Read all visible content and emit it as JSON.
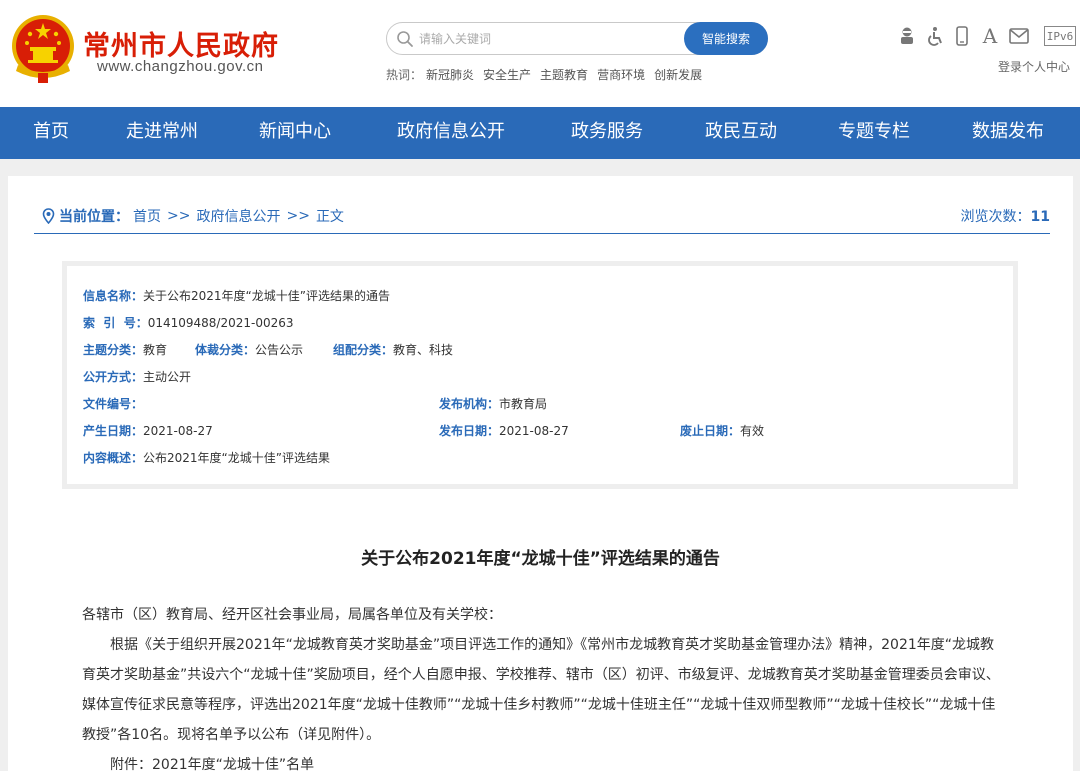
{
  "site": {
    "name": "常州市人民政府",
    "url": "www.changzhou.gov.cn"
  },
  "search": {
    "placeholder": "请输入关键词",
    "button_label": "智能搜索"
  },
  "hot": {
    "label": "热词：",
    "words": [
      "新冠肺炎",
      "安全生产",
      "主题教育",
      "营商环境",
      "创新发展"
    ]
  },
  "tools": {
    "icons": [
      "elderly-mode-icon",
      "accessibility-icon",
      "mobile-icon",
      "font-size-icon",
      "mail-icon",
      "ipv6-icon"
    ],
    "font_label": "A",
    "ipv6_label": "IPv6",
    "login_label": "登录个人中心"
  },
  "nav": {
    "items": [
      "首页",
      "走进常州",
      "新闻中心",
      "政府信息公开",
      "政务服务",
      "政民互动",
      "专题专栏",
      "数据发布"
    ]
  },
  "breadcrumb": {
    "label": "当前位置：",
    "items": [
      "首页",
      "政府信息公开",
      "正文"
    ],
    "separator": ">>"
  },
  "views": {
    "label": "浏览次数：",
    "count": "11"
  },
  "meta": {
    "info_name_key": "信息名称：",
    "info_name_val": "关于公布2021年度“龙城十佳”评选结果的通告",
    "index_key": "索  引  号：",
    "index_val": "014109488/2021-00263",
    "topic_key": "主题分类：",
    "topic_val": "教育",
    "genre_key": "体裁分类：",
    "genre_val": "公告公示",
    "org_class_key": "组配分类：",
    "org_class_val": "教育、科技",
    "open_mode_key": "公开方式：",
    "open_mode_val": "主动公开",
    "doc_no_key": "文件编号：",
    "doc_no_val": "",
    "publisher_key": "发布机构：",
    "publisher_val": "市教育局",
    "created_key": "产生日期：",
    "created_val": "2021-08-27",
    "published_key": "发布日期：",
    "published_val": "2021-08-27",
    "expire_key": "废止日期：",
    "expire_val": "有效",
    "summary_key": "内容概述：",
    "summary_val": "公布2021年度“龙城十佳”评选结果"
  },
  "doc": {
    "title": "关于公布2021年度“龙城十佳”评选结果的通告",
    "salutation": "各辖市（区）教育局、经开区社会事业局，局属各单位及有关学校：",
    "paragraph": "根据《关于组织开展2021年“龙城教育英才奖助基金”项目评选工作的通知》《常州市龙城教育英才奖助基金管理办法》精神，2021年度“龙城教育英才奖助基金”共设六个“龙城十佳”奖励项目，经个人自愿申报、学校推荐、辖市（区）初评、市级复评、龙城教育英才奖助基金管理委员会审议、媒体宣传征求民意等程序，评选出2021年度“龙城十佳教师”“龙城十佳乡村教师”“龙城十佳班主任”“龙城十佳双师型教师”“龙城十佳校长”“龙城十佳教授”各10名。现将名单予以公布（详见附件）。",
    "attachment": "附件：2021年度“龙城十佳”名单"
  },
  "colors": {
    "brand_red": "#d81e06",
    "nav_blue": "#2a6ab8",
    "search_blue": "#2b6fbf"
  }
}
